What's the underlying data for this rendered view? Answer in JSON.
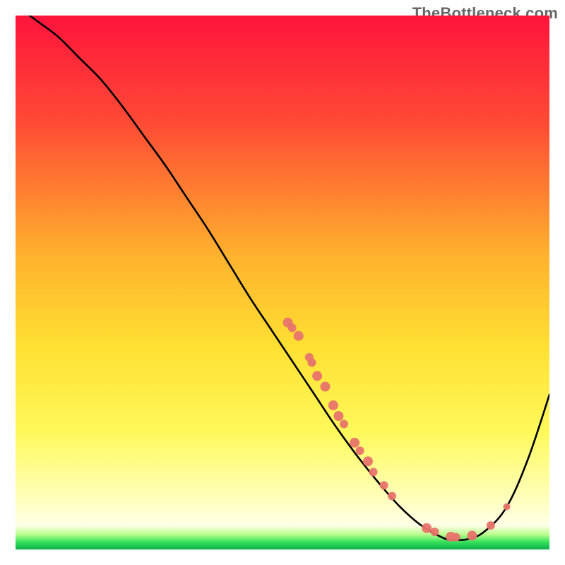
{
  "watermark": "TheBottleneck.com",
  "colors": {
    "gradient_stops": [
      {
        "offset": 0.0,
        "color": "#ff143c"
      },
      {
        "offset": 0.2,
        "color": "#ff4a35"
      },
      {
        "offset": 0.45,
        "color": "#ffb22d"
      },
      {
        "offset": 0.62,
        "color": "#ffe032"
      },
      {
        "offset": 0.78,
        "color": "#fff95a"
      },
      {
        "offset": 0.9,
        "color": "#ffffb8"
      },
      {
        "offset": 0.955,
        "color": "#ffffe8"
      },
      {
        "offset": 0.972,
        "color": "#b9ff8c"
      },
      {
        "offset": 0.986,
        "color": "#36e05a"
      },
      {
        "offset": 1.0,
        "color": "#0cb14a"
      }
    ],
    "curve": "#000000",
    "dot_fill": "#e8746b",
    "dot_stroke": "#e8746b"
  },
  "chart_data": {
    "type": "line",
    "title": "",
    "xlabel": "",
    "ylabel": "",
    "xlim": [
      0,
      100
    ],
    "ylim": [
      0,
      100
    ],
    "series": [
      {
        "name": "bottleneck-curve",
        "x": [
          0,
          4,
          8,
          12,
          16,
          20,
          24,
          28,
          32,
          36,
          40,
          44,
          48,
          52,
          56,
          60,
          64,
          68,
          72,
          76,
          80,
          82,
          85,
          88,
          92,
          96,
          100
        ],
        "y": [
          102,
          99,
          96,
          92,
          88,
          83,
          77.5,
          72,
          66,
          60,
          53.5,
          47,
          41,
          35,
          29,
          23,
          17.5,
          12.5,
          8,
          4.5,
          2.2,
          1.8,
          2.0,
          3.5,
          8,
          17,
          29
        ]
      }
    ],
    "scatter": [
      {
        "x": 51.0,
        "y": 42.5,
        "r": 7
      },
      {
        "x": 51.8,
        "y": 41.5,
        "r": 6
      },
      {
        "x": 53.0,
        "y": 40.0,
        "r": 7
      },
      {
        "x": 55.0,
        "y": 36.0,
        "r": 6
      },
      {
        "x": 55.5,
        "y": 35.0,
        "r": 6
      },
      {
        "x": 56.5,
        "y": 32.5,
        "r": 7
      },
      {
        "x": 58.0,
        "y": 30.5,
        "r": 7
      },
      {
        "x": 59.5,
        "y": 27.0,
        "r": 7
      },
      {
        "x": 60.5,
        "y": 25.0,
        "r": 7
      },
      {
        "x": 61.5,
        "y": 23.5,
        "r": 6
      },
      {
        "x": 63.5,
        "y": 20.0,
        "r": 7
      },
      {
        "x": 64.5,
        "y": 18.5,
        "r": 6
      },
      {
        "x": 66.0,
        "y": 16.5,
        "r": 7
      },
      {
        "x": 67.0,
        "y": 14.5,
        "r": 6
      },
      {
        "x": 69.0,
        "y": 12.0,
        "r": 6
      },
      {
        "x": 70.5,
        "y": 10.0,
        "r": 6
      },
      {
        "x": 77.0,
        "y": 4.0,
        "r": 7
      },
      {
        "x": 78.5,
        "y": 3.3,
        "r": 6
      },
      {
        "x": 81.5,
        "y": 2.4,
        "r": 7
      },
      {
        "x": 82.5,
        "y": 2.3,
        "r": 6
      },
      {
        "x": 85.5,
        "y": 2.6,
        "r": 7
      },
      {
        "x": 89.0,
        "y": 4.5,
        "r": 6
      },
      {
        "x": 92.0,
        "y": 8.0,
        "r": 5
      }
    ]
  }
}
